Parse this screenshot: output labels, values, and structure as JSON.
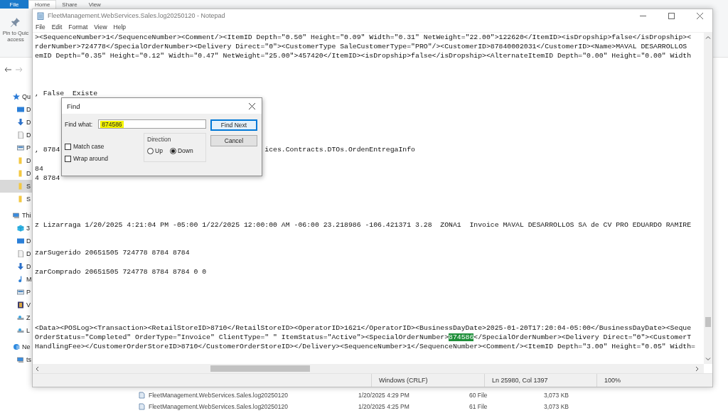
{
  "explorer": {
    "file_menu": "File",
    "tabs": [
      {
        "label": "Home",
        "selected": true
      },
      {
        "label": "Share",
        "selected": false
      },
      {
        "label": "View",
        "selected": false
      }
    ],
    "pin_button": {
      "label_lines": [
        "Pin to Quic",
        "access"
      ]
    },
    "nav_items": [
      {
        "kind": "star",
        "label": "Qu",
        "selected": false,
        "children": [
          {
            "kind": "desktop",
            "label": "D",
            "selected": false
          },
          {
            "kind": "download",
            "label": "D",
            "selected": false
          },
          {
            "kind": "document",
            "label": "D",
            "selected": false
          },
          {
            "kind": "pictures",
            "label": "P",
            "selected": false
          },
          {
            "kind": "folder",
            "label": "D",
            "selected": false
          },
          {
            "kind": "folder",
            "label": "D",
            "selected": false
          },
          {
            "kind": "folder",
            "label": "S",
            "selected": true
          },
          {
            "kind": "folder",
            "label": "S",
            "selected": false
          }
        ]
      },
      {
        "kind": "pc",
        "label": "Thi",
        "selected": false,
        "children": [
          {
            "kind": "cube",
            "label": "3",
            "selected": false
          },
          {
            "kind": "desktop",
            "label": "D",
            "selected": false
          },
          {
            "kind": "document",
            "label": "D",
            "selected": false
          },
          {
            "kind": "download",
            "label": "D",
            "selected": false
          },
          {
            "kind": "music",
            "label": "M",
            "selected": false
          },
          {
            "kind": "pictures",
            "label": "P",
            "selected": false
          },
          {
            "kind": "video",
            "label": "V",
            "selected": false
          },
          {
            "kind": "drive",
            "label": "Z",
            "selected": false
          },
          {
            "kind": "drive",
            "label": "L",
            "selected": false
          }
        ]
      },
      {
        "kind": "network",
        "label": "Ne",
        "selected": false,
        "children": [
          {
            "kind": "pc",
            "label": "ts",
            "selected": false
          }
        ]
      }
    ],
    "files": [
      {
        "name": "FleetManagement.WebServices.Sales.log20250120",
        "date": "1/20/2025 4:29 PM",
        "type": "60 File",
        "size": "3,073 KB"
      },
      {
        "name": "FleetManagement.WebServices.Sales.log20250120",
        "date": "1/20/2025 4:25 PM",
        "type": "61 File",
        "size": "3,073 KB"
      }
    ]
  },
  "notepad": {
    "title": "FleetManagement.WebServices.Sales.log20250120 - Notepad",
    "menu": [
      "File",
      "Edit",
      "Format",
      "View",
      "Help"
    ],
    "lines": [
      {
        "kind": "text",
        "text": "><SequenceNumber>1</SequenceNumber><Comment/><ItemID Depth=\"0.50\" Height=\"0.09\" Width=\"0.31\" NetWeight=\"22.00\">122620</ItemID><isDropship>false</isDropship><"
      },
      {
        "kind": "text",
        "text": "rderNumber>724778</SpecialOrderNumber><Delivery Direct=\"0\"><CustomerType SaleCustomerType=\"PRO\"/><CustomerID>87840002031</CustomerID><Name>MAVAL DESARROLLOS"
      },
      {
        "kind": "text",
        "text": "emID Depth=\"0.35\" Height=\"0.12\" Width=\"0.47\" NetWeight=\"25.00\">457420</ItemID><isDropship>false</isDropship><AlternateItemID Depth=\"0.00\" Height=\"0.00\" Width"
      },
      {
        "kind": "blank"
      },
      {
        "kind": "blank"
      },
      {
        "kind": "blank"
      },
      {
        "kind": "text",
        "text": ", False  Existe"
      },
      {
        "kind": "blank"
      },
      {
        "kind": "blank"
      },
      {
        "kind": "blank"
      },
      {
        "kind": "blank"
      },
      {
        "kind": "blank"
      },
      {
        "kind": "text",
        "text": ", 8784",
        "text_right": "ices.Contracts.DTOs.OrdenEntregaInfo"
      },
      {
        "kind": "blank"
      },
      {
        "kind": "text",
        "text": "84"
      },
      {
        "kind": "text",
        "text": "4 8784"
      },
      {
        "kind": "blank"
      },
      {
        "kind": "blank"
      },
      {
        "kind": "blank"
      },
      {
        "kind": "blank"
      },
      {
        "kind": "text",
        "text": "z Lizarraga 1/20/2025 4:21:04 PM -05:00 1/22/2025 12:00:00 AM -06:00 23.218986 -106.421371 3.28  ZONA1  Invoice MAVAL DESARROLLOS SA de CV PRO EDUARDO RAMIRE"
      },
      {
        "kind": "blank"
      },
      {
        "kind": "blank"
      },
      {
        "kind": "text",
        "text": "zarSugerido 20651505 724778 8784 8784"
      },
      {
        "kind": "blank"
      },
      {
        "kind": "text",
        "text": "zarComprado 20651505 724778 8784 8784 0 0"
      },
      {
        "kind": "blank"
      },
      {
        "kind": "blank"
      },
      {
        "kind": "blank"
      },
      {
        "kind": "blank"
      },
      {
        "kind": "blank"
      },
      {
        "kind": "text",
        "text": "<Data><POSLog><Transaction><RetailStoreID>8710</RetailStoreID><OperatorID>1621</OperatorID><BusinessDayDate>2025-01-20T17:20:04-05:00</BusinessDayDate><Seque"
      },
      {
        "kind": "segmented",
        "segments": [
          {
            "text": "OrderStatus=\"Completed\" OrderType=\"Invoice\" ClientType=\" \" ItemStatus=\"Active\"><SpecialOrderNumber>",
            "selected": false
          },
          {
            "text": "874586",
            "selected": true
          },
          {
            "text": "</SpecialOrderNumber><Delivery Direct=\"0\"><CustomerT",
            "selected": false
          }
        ]
      },
      {
        "kind": "text",
        "text": "HandlingFee></CustomerOrderStoreID>8710</CustomerOrderStoreID></Delivery><SequenceNumber>1</SequenceNumber><Comment/><ItemID Depth=\"3.00\" Height=\"0.05\" Width="
      }
    ],
    "status_bar": {
      "line_ending": "Windows (CRLF)",
      "position": "Ln 25980, Col 1397",
      "zoom": "100%"
    }
  },
  "find_dialog": {
    "title": "Find",
    "find_what_label": "Find what:",
    "find_what_value": "874586",
    "highlighted": true,
    "checkboxes": [
      {
        "label": "Match case",
        "checked": false
      },
      {
        "label": "Wrap around",
        "checked": false
      }
    ],
    "direction_label": "Direction",
    "directions": [
      {
        "label": "Up",
        "selected": false
      },
      {
        "label": "Down",
        "selected": true
      }
    ],
    "buttons": [
      {
        "label": "Find Next",
        "kind": "default"
      },
      {
        "label": "Cancel",
        "kind": "normal"
      }
    ]
  }
}
